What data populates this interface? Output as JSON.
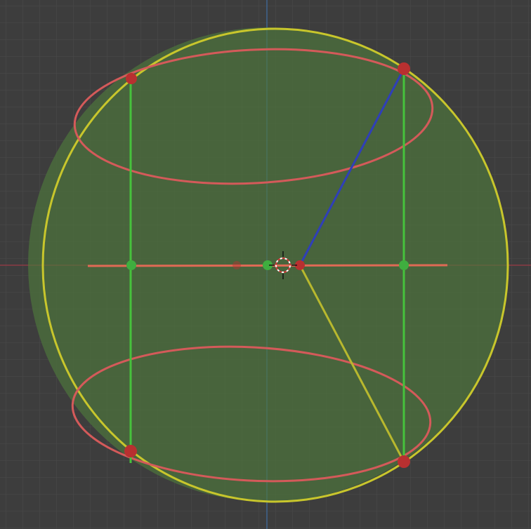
{
  "viewport": {
    "background": "#3d3d3d",
    "grid_color": "#4a4a4a",
    "x_axis_color": "#9b3b46",
    "y_axis_color": "#3f6fa3"
  },
  "colors": {
    "sphere_fill": "#4e7a3c",
    "sphere_edge": "#c8c62c",
    "ellipse": "#d45a5a",
    "vertical_edge": "#46c23c",
    "blue_edge": "#2f3fb8",
    "yellow_edge": "#b8b82e",
    "vertex": "#b83030",
    "midpoint": "#3fae3f",
    "cursor": "#ffffff"
  },
  "icons": {
    "cursor": "3d-cursor-icon"
  }
}
